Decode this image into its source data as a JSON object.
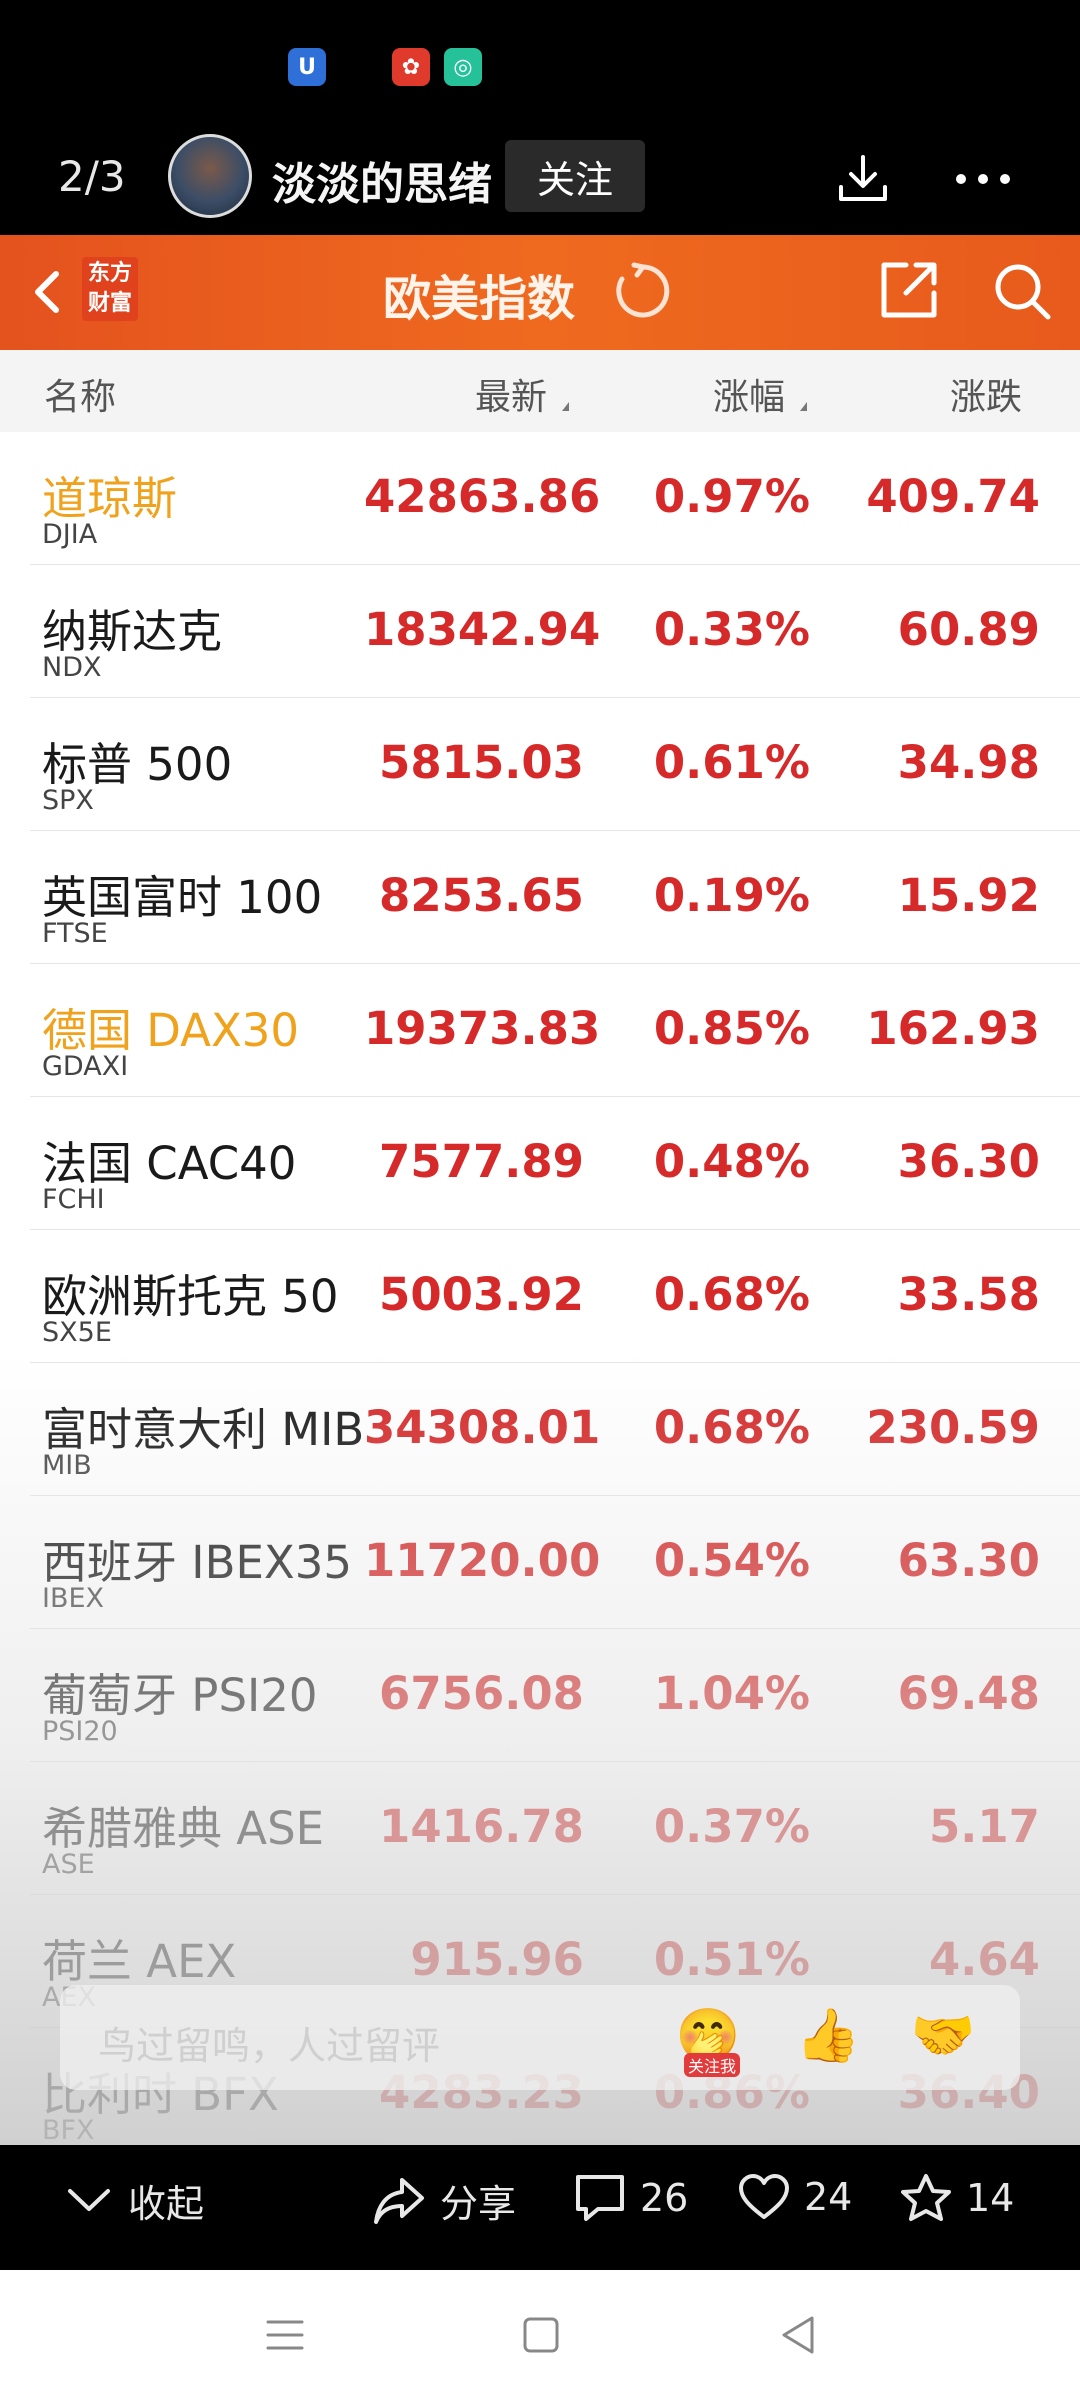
{
  "post": {
    "page_indicator": "2/3",
    "username": "淡淡的思绪",
    "follow_label": "关注"
  },
  "appbar": {
    "logo_line1": "东方",
    "logo_line2": "财富",
    "title": "欧美指数"
  },
  "columns": {
    "name": "名称",
    "latest": "最新",
    "pct": "涨幅",
    "chg": "涨跌"
  },
  "rows": [
    {
      "name": "道琼斯",
      "code": "DJIA",
      "latest": "42863.86",
      "pct": "0.97%",
      "chg": "409.74",
      "highlight": true
    },
    {
      "name": "纳斯达克",
      "code": "NDX",
      "latest": "18342.94",
      "pct": "0.33%",
      "chg": "60.89",
      "highlight": false
    },
    {
      "name": "标普 500",
      "code": "SPX",
      "latest": "5815.03",
      "pct": "0.61%",
      "chg": "34.98",
      "highlight": false
    },
    {
      "name": "英国富时 100",
      "code": "FTSE",
      "latest": "8253.65",
      "pct": "0.19%",
      "chg": "15.92",
      "highlight": false
    },
    {
      "name": "德国 DAX30",
      "code": "GDAXI",
      "latest": "19373.83",
      "pct": "0.85%",
      "chg": "162.93",
      "highlight": true
    },
    {
      "name": "法国 CAC40",
      "code": "FCHI",
      "latest": "7577.89",
      "pct": "0.48%",
      "chg": "36.30",
      "highlight": false
    },
    {
      "name": "欧洲斯托克 50",
      "code": "SX5E",
      "latest": "5003.92",
      "pct": "0.68%",
      "chg": "33.58",
      "highlight": false
    },
    {
      "name": "富时意大利 MIB",
      "code": "MIB",
      "latest": "34308.01",
      "pct": "0.68%",
      "chg": "230.59",
      "highlight": false
    },
    {
      "name": "西班牙 IBEX35",
      "code": "IBEX",
      "latest": "11720.00",
      "pct": "0.54%",
      "chg": "63.30",
      "highlight": false
    },
    {
      "name": "葡萄牙 PSI20",
      "code": "PSI20",
      "latest": "6756.08",
      "pct": "1.04%",
      "chg": "69.48",
      "highlight": false
    },
    {
      "name": "希腊雅典 ASE",
      "code": "ASE",
      "latest": "1416.78",
      "pct": "0.37%",
      "chg": "5.17",
      "highlight": false
    },
    {
      "name": "荷兰 AEX",
      "code": "AEX",
      "latest": "915.96",
      "pct": "0.51%",
      "chg": "4.64",
      "highlight": false
    },
    {
      "name": "比利时 BFX",
      "code": "BFX",
      "latest": "4283.23",
      "pct": "0.86%",
      "chg": "36.40",
      "highlight": false
    }
  ],
  "comment": {
    "placeholder": "鸟过留鸣，人过留评",
    "emoji_badge": "关注我"
  },
  "actions": {
    "collapse": "收起",
    "share": "分享",
    "comments": "26",
    "likes": "24",
    "favorites": "14"
  },
  "colors": {
    "accent_orange": "#e85a1c",
    "value_red": "#d62a2a",
    "highlight_gold": "#f0a21c"
  }
}
